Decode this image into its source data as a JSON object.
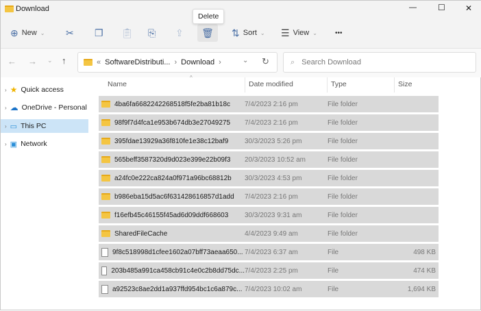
{
  "window": {
    "title": "Download",
    "minimize": "—",
    "maximize": "☐",
    "close": "✕"
  },
  "toolbar": {
    "new": "New",
    "sort": "Sort",
    "view": "View",
    "more": "•••",
    "tooltip": "Delete"
  },
  "nav": {
    "breadcrumb": [
      "«",
      "SoftwareDistributi...",
      "›",
      "Download",
      "›"
    ],
    "search_placeholder": "Search Download"
  },
  "sidebar": {
    "items": [
      {
        "label": "Quick access"
      },
      {
        "label": "OneDrive - Personal"
      },
      {
        "label": "This PC"
      },
      {
        "label": "Network"
      }
    ]
  },
  "columns": [
    "Name",
    "Date modified",
    "Type",
    "Size"
  ],
  "files": [
    {
      "name": "4ba6fa6682242268518f5fe2ba81b18c",
      "date": "7/4/2023 2:16 pm",
      "type": "File folder",
      "size": "",
      "kind": "folder"
    },
    {
      "name": "98f9f7d4fca1e953b674db3e27049275",
      "date": "7/4/2023 2:16 pm",
      "type": "File folder",
      "size": "",
      "kind": "folder"
    },
    {
      "name": "395fdae13929a36f810fe1e38c12baf9",
      "date": "30/3/2023 5:26 pm",
      "type": "File folder",
      "size": "",
      "kind": "folder"
    },
    {
      "name": "565beff3587320d9d023e399e22b09f3",
      "date": "20/3/2023 10:52 am",
      "type": "File folder",
      "size": "",
      "kind": "folder"
    },
    {
      "name": "a24fc0e222ca824a0f971a96bc68812b",
      "date": "30/3/2023 4:53 pm",
      "type": "File folder",
      "size": "",
      "kind": "folder"
    },
    {
      "name": "b986eba15d5ac6f631428616857d1add",
      "date": "7/4/2023 2:16 pm",
      "type": "File folder",
      "size": "",
      "kind": "folder"
    },
    {
      "name": "f16efb45c46155f45ad6d09ddf668603",
      "date": "30/3/2023 9:31 am",
      "type": "File folder",
      "size": "",
      "kind": "folder"
    },
    {
      "name": "SharedFileCache",
      "date": "4/4/2023 9:49 am",
      "type": "File folder",
      "size": "",
      "kind": "folder"
    },
    {
      "name": "9f8c518998d1cfee1602a07bff73aeaa650...",
      "date": "7/4/2023 6:37 am",
      "type": "File",
      "size": "498 KB",
      "kind": "file"
    },
    {
      "name": "203b485a991ca458cb91c4e0c2b8dd75dc...",
      "date": "7/4/2023 2:25 pm",
      "type": "File",
      "size": "474 KB",
      "kind": "file"
    },
    {
      "name": "a92523c8ae2dd1a937ffd954bc1c6a879c...",
      "date": "7/4/2023 10:02 am",
      "type": "File",
      "size": "1,694 KB",
      "kind": "file"
    }
  ]
}
